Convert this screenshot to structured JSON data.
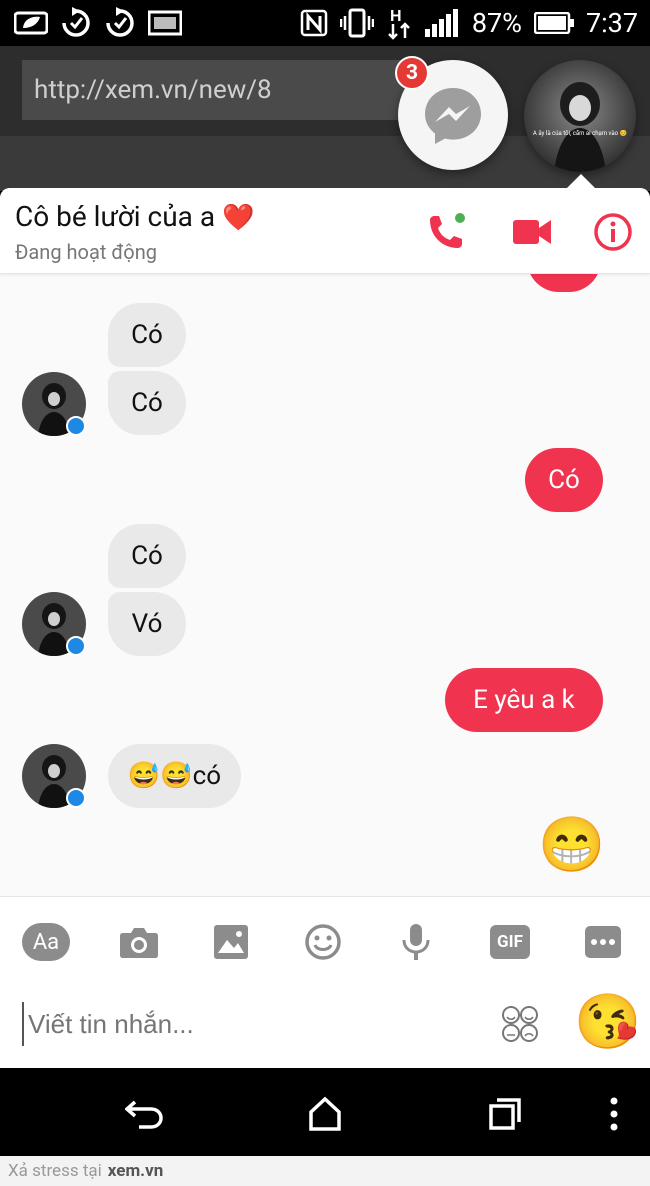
{
  "status_bar": {
    "battery": "87%",
    "time": "7:37",
    "network": "H",
    "nfc": "N"
  },
  "browser": {
    "url": "http://xem.vn/new/8"
  },
  "chat_heads": {
    "unread_count": "3",
    "avatar_caption": "A ây là của tôi, cấm ai chạm vào 😊"
  },
  "conversation": {
    "contact_name": "Cô bé lười của a",
    "contact_heart": "❤️",
    "status": "Đang hoạt động"
  },
  "messages": [
    {
      "from": "them",
      "text": "Có"
    },
    {
      "from": "them",
      "text": "Có"
    },
    {
      "from": "me",
      "text": "Có"
    },
    {
      "from": "them",
      "text": "Có"
    },
    {
      "from": "them",
      "text": "Vó"
    },
    {
      "from": "me",
      "text": "E yêu a k"
    },
    {
      "from": "them",
      "text": "😅😅có"
    },
    {
      "from": "me",
      "text": "😁"
    }
  ],
  "composer": {
    "aa_label": "Aa",
    "gif_label": "GIF",
    "placeholder": "Viết tin nhắn...",
    "quick_reaction": "😘"
  },
  "footer": {
    "prefix": "Xả stress tại",
    "site": "xem.vn"
  },
  "colors": {
    "accent": "#f0334f",
    "messenger_blue": "#1e88e5",
    "online": "#4caf50"
  }
}
